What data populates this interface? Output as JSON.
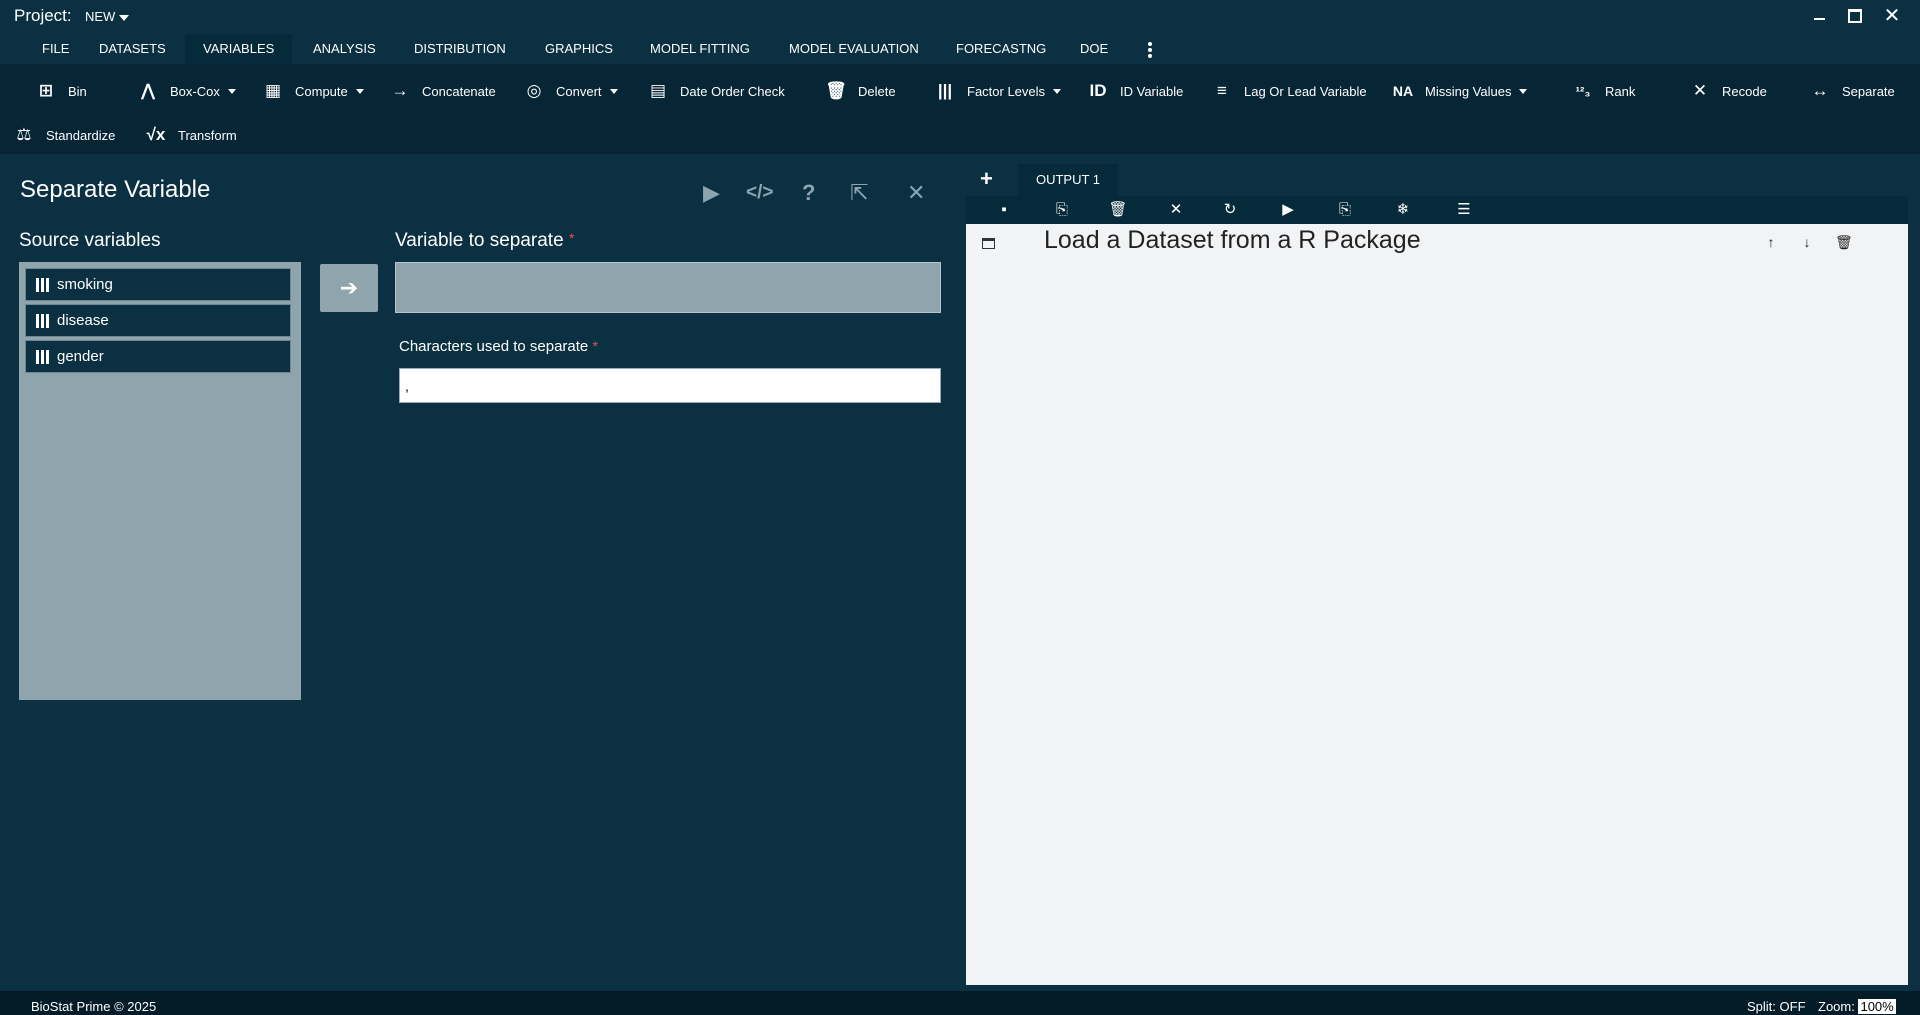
{
  "titlebar": {
    "project_label": "Project:",
    "project_value": "NEW"
  },
  "menu": {
    "tabs": [
      {
        "label": "FILE"
      },
      {
        "label": "DATASETS"
      },
      {
        "label": "VARIABLES"
      },
      {
        "label": "ANALYSIS"
      },
      {
        "label": "DISTRIBUTION"
      },
      {
        "label": "GRAPHICS"
      },
      {
        "label": "MODEL FITTING"
      },
      {
        "label": "MODEL EVALUATION"
      },
      {
        "label": "FORECASTNG"
      },
      {
        "label": "DOE"
      }
    ],
    "active": "VARIABLES"
  },
  "ribbon": {
    "items": [
      {
        "label": "Bin",
        "icon": "grid-icon"
      },
      {
        "label": "Box-Cox",
        "icon": "bell-curve-icon"
      },
      {
        "label": "Compute",
        "icon": "calculator-icon"
      },
      {
        "label": "Concatenate",
        "icon": "concatenate-icon"
      },
      {
        "label": "Convert",
        "icon": "convert-icon"
      },
      {
        "label": "Date Order Check",
        "icon": "calendar-icon"
      },
      {
        "label": "Delete",
        "icon": "trash-icon"
      },
      {
        "label": "Factor Levels",
        "icon": "columns-icon"
      },
      {
        "label": "ID Variable",
        "icon": "id-icon",
        "glyph": "ID"
      },
      {
        "label": "Lag Or Lead Variable",
        "icon": "lag-lead-icon"
      },
      {
        "label": "Missing Values",
        "icon": "na-icon",
        "glyph": "NA"
      },
      {
        "label": "Rank",
        "icon": "rank-icon"
      },
      {
        "label": "Recode",
        "icon": "recode-icon"
      },
      {
        "label": "Separate",
        "icon": "separate-icon"
      },
      {
        "label": "Standardize",
        "icon": "scale-icon"
      },
      {
        "label": "Transform",
        "icon": "sqrt-icon"
      }
    ]
  },
  "panel": {
    "title": "Separate Variable",
    "source_label": "Source variables",
    "source_vars": [
      "smoking",
      "disease",
      "gender"
    ],
    "target_label": "Variable to separate",
    "required_mark": "*",
    "sep_label": "Characters used to separate",
    "sep_value": ","
  },
  "output": {
    "tab_label": "OUTPUT 1",
    "heading": "Load a Dataset from a R Package"
  },
  "statusbar": {
    "copyright": "BioStat Prime © 2025",
    "split": "Split: OFF",
    "zoom_label": "Zoom:",
    "zoom_value": "100%"
  }
}
